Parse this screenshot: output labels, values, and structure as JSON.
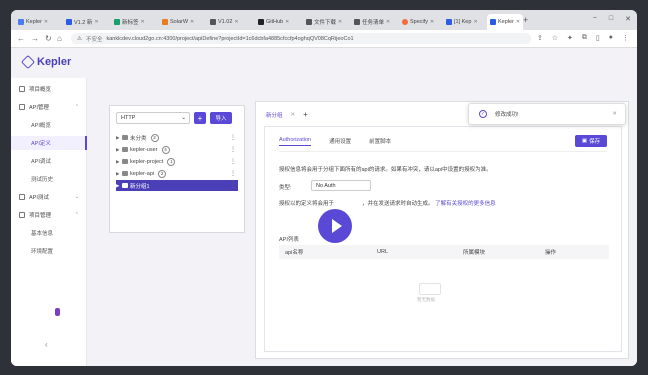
{
  "browser": {
    "tabs": [
      {
        "label": "Kepler",
        "color": "#4b7bec"
      },
      {
        "label": "V1.2 新",
        "color": "#2d5be3"
      },
      {
        "label": "新标签",
        "color": "#1a9e6e"
      },
      {
        "label": "SolarW",
        "color": "#e67e22"
      },
      {
        "label": "V1.02",
        "color": "#555555"
      },
      {
        "label": "GitHub",
        "color": "#222222"
      },
      {
        "label": "文件下载",
        "color": "#555555"
      },
      {
        "label": "任务清单",
        "color": "#555555"
      },
      {
        "label": "Specify",
        "color": "#f26b3a"
      },
      {
        "label": "[1] Kep",
        "color": "#2d5be3"
      },
      {
        "label": "Kepler",
        "color": "#2d5be3"
      }
    ],
    "active_tab_index": 10,
    "url_security": "不安全",
    "url": "kanklcdev.cloud2go.cn:4300/project/apiDefine?projectId=1c6dcbfa4885cfccfp4oghqQV08CqRijeoCo1"
  },
  "app": {
    "logo": "Kepler",
    "sidebar": {
      "items": [
        {
          "label": "项目概览",
          "kind": "group"
        },
        {
          "label": "API管理",
          "kind": "group",
          "expanded": true
        },
        {
          "label": "API概览",
          "kind": "sub"
        },
        {
          "label": "API定义",
          "kind": "sub",
          "selected": true
        },
        {
          "label": "API调试",
          "kind": "sub"
        },
        {
          "label": "测试历史",
          "kind": "sub"
        },
        {
          "label": "API测试",
          "kind": "group",
          "expanded": false
        },
        {
          "label": "项目管理",
          "kind": "group",
          "expanded": true
        },
        {
          "label": "基本信息",
          "kind": "sub"
        },
        {
          "label": "环境配置",
          "kind": "sub"
        }
      ],
      "collapse_icon": "chevron-left-icon"
    },
    "tree": {
      "method": "HTTP",
      "add_label": "+",
      "import_label": "导入",
      "rows": [
        {
          "label": "未分类",
          "count": "2"
        },
        {
          "label": "kepler-user",
          "count": "4"
        },
        {
          "label": "kepler-project",
          "count": "1"
        },
        {
          "label": "kepler-api",
          "count": "2"
        },
        {
          "label": "新分组1",
          "count": "",
          "active": true
        }
      ]
    },
    "main": {
      "tab_label": "新分组",
      "subtabs": [
        "Authorization",
        "通用设置",
        "前置脚本"
      ],
      "save_label": "保存",
      "desc1": "授权信息将会用于分组下面所有的api的请求。如果有冲突，请以api中设置的授权为准。",
      "type_label": "类型:",
      "type_value": "No Auth",
      "desc2_prefix": "授权以的定义将会用于",
      "desc2_mid": "，并在发送请求时自动生成。",
      "desc2_link": "了解有关授权的更多信息",
      "api_list_title": "API列表",
      "columns": [
        "api名称",
        "URL",
        "所属模块",
        "操作"
      ],
      "empty_label": "暂无数据"
    },
    "toast": {
      "message": "修改成功!"
    }
  }
}
